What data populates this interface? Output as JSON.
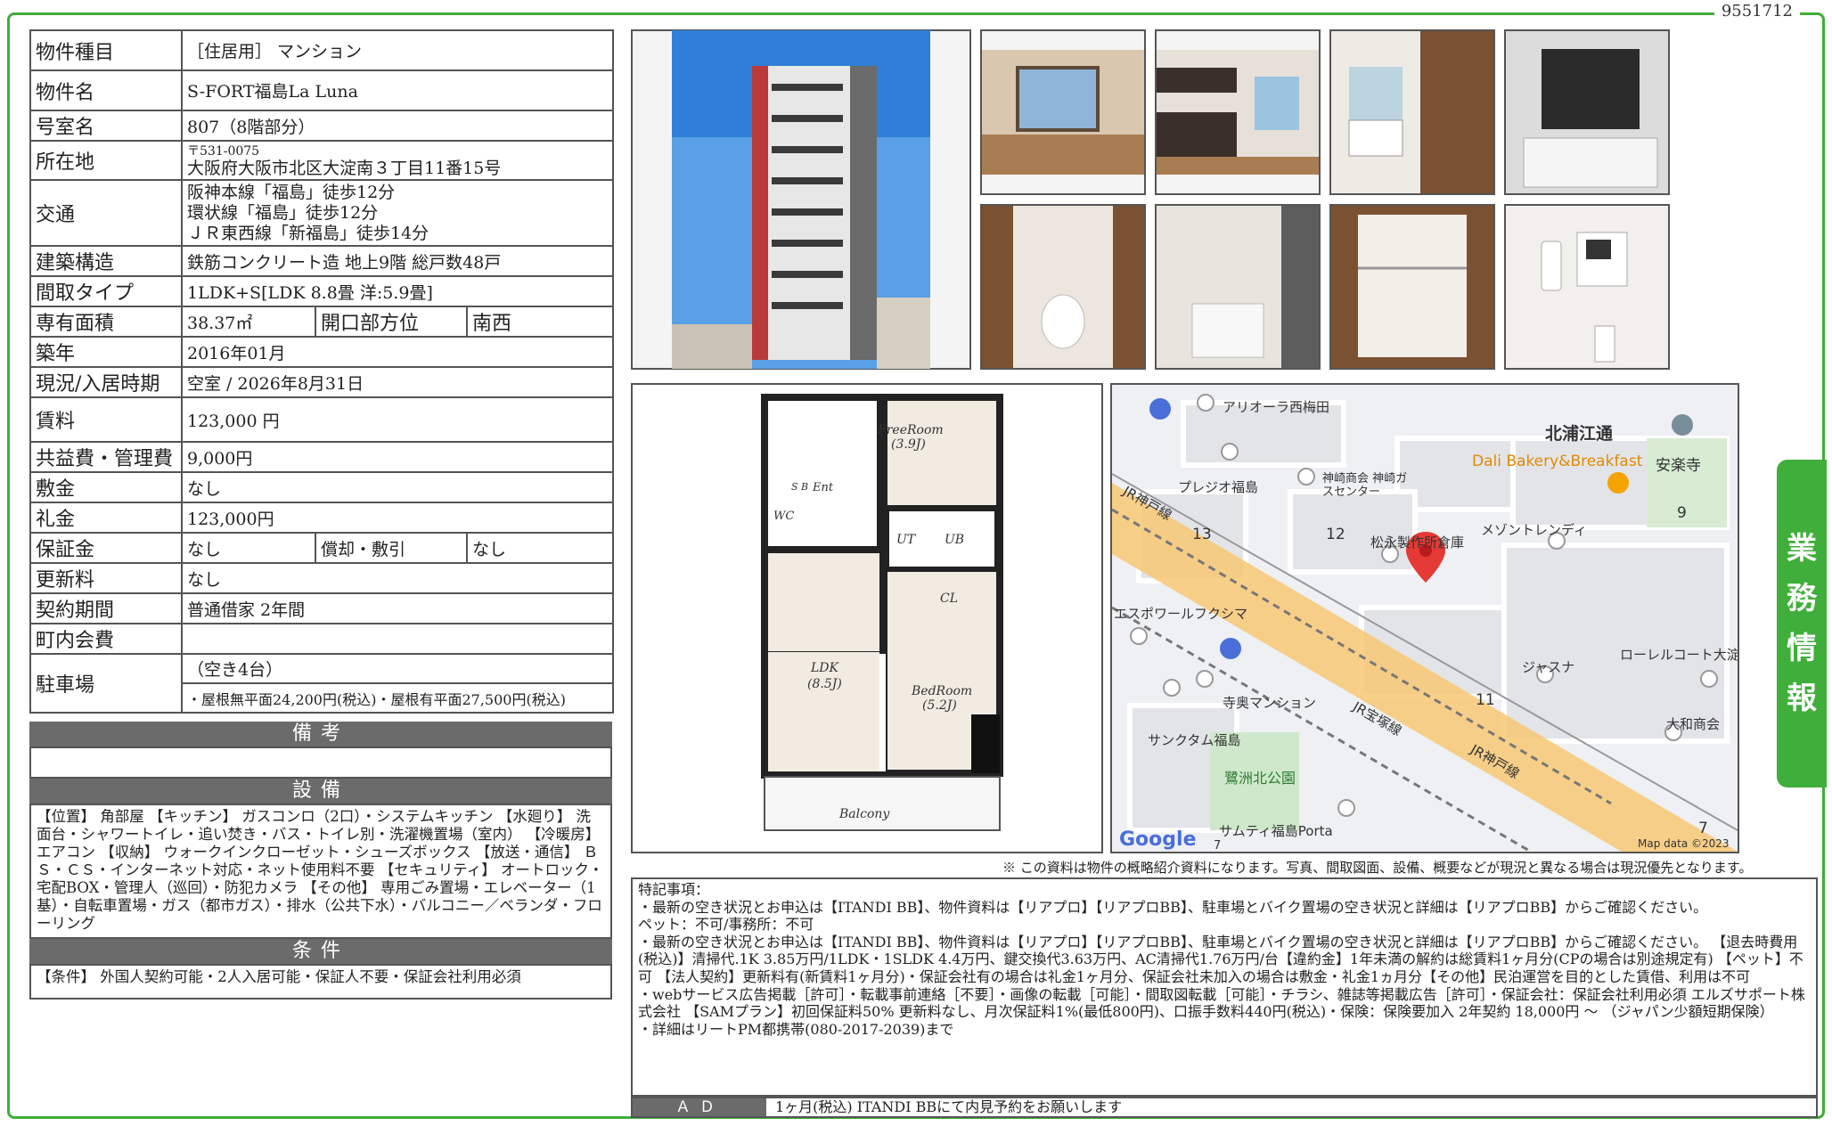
{
  "doc_id": "9551712",
  "side_tab": [
    "業",
    "務",
    "情",
    "報"
  ],
  "rows": {
    "type_label": "物件種目",
    "type_value": "［住居用］ マンション",
    "name_label": "物件名",
    "name_value": "S-FORT福島La Luna",
    "room_label": "号室名",
    "room_value": "807（8階部分）",
    "addr_label": "所在地",
    "addr_zip": "〒531-0075",
    "addr_value": "大阪府大阪市北区大淀南３丁目11番15号",
    "access_label": "交通",
    "access_1": "阪神本線「福島」徒歩12分",
    "access_2": "環状線「福島」徒歩12分",
    "access_3": "ＪＲ東西線「新福島」徒歩14分",
    "struct_label": "建築構造",
    "struct_value": "鉄筋コンクリート造 地上9階 総戸数48戸",
    "layout_label": "間取タイプ",
    "layout_value": "1LDK+S[LDK 8.8畳 洋:5.9畳]",
    "area_label": "専有面積",
    "area_value": "38.37㎡",
    "dir_label": "開口部方位",
    "dir_value": "南西",
    "built_label": "築年",
    "built_value": "2016年01月",
    "status_label": "現況/入居時期",
    "status_value": "空室 / 2026年8月31日",
    "rent_label": "賃料",
    "rent_value": "123,000 円",
    "fee_label": "共益費・管理費",
    "fee_value": "9,000円",
    "deposit_label": "敷金",
    "deposit_value": "なし",
    "key_label": "礼金",
    "key_value": "123,000円",
    "guar_label": "保証金",
    "guar_value": "なし",
    "amort_label": "償却・敷引",
    "amort_value": "なし",
    "renew_label": "更新料",
    "renew_value": "なし",
    "term_label": "契約期間",
    "term_value": "普通借家 2年間",
    "town_label": "町内会費",
    "town_value": "",
    "park_label": "駐車場",
    "park_value1": "（空き4台）",
    "park_value2": "・屋根無平面24,200円(税込)・屋根有平面27,500円(税込)"
  },
  "sections": {
    "biko": "備考",
    "setsubi": "設備",
    "joken": "条件",
    "ad": "ＡＤ"
  },
  "setsubi_text": "【位置】 角部屋 【キッチン】 ガスコンロ（2口）・システムキッチン 【水廻り】 洗面台・シャワートイレ・追い焚き・バス・トイレ別・洗濯機置場（室内） 【冷暖房】 エアコン 【収納】 ウォークインクローゼット・シューズボックス 【放送・通信】 ＢＳ・ＣＳ・インターネット対応・ネット使用料不要 【セキュリティ】 オートロック・宅配BOX・管理人（巡回）・防犯カメラ 【その他】 専用ごみ置場・エレベーター（1基）・自転車置場・ガス（都市ガス）・排水（公共下水）・バルコニー／ベランダ・フローリング",
  "joken_text": "【条件】 外国人契約可能・2人入居可能・保証人不要・保証会社利用必須",
  "note": "※ この資料は物件の概略紹介資料になります。写真、間取図面、設備、概要などが現況と異なる場合は現況優先となります。",
  "remarks": [
    "特記事項：",
    "・最新の空き状況とお申込は【ITANDI BB】、物件資料は【リアプロ】【リアプロBB】、駐車場とバイク置場の空き状況と詳細は【リアプロBB】からご確認ください。",
    "ペット：不可/事務所：不可",
    "・最新の空き状況とお申込は【ITANDI BB】、物件資料は【リアプロ】【リアプロBB】、駐車場とバイク置場の空き状況と詳細は【リアプロBB】からご確認ください。 【退去時費用(税込)】清掃代.1K 3.85万円/1LDK・1SLDK 4.4万円、鍵交換代3.63万円、AC清掃代1.76万円/台【違約金】1年未満の解約は総賃料1ヶ月分(CPの場合は別途規定有) 【ペット】不可 【法人契約】更新料有(新賃料1ヶ月分)・保証会社有の場合は礼金1ヶ月分、保証会社未加入の場合は敷金・礼金1ヵ月分【その他】民泊運営を目的とした賃借、利用は不可",
    "・webサービス広告掲載［許可］・転載事前連絡［不要］・画像の転載［可能］・間取図転載［可能］・チラシ、雑誌等掲載広告［許可］・保証会社：保証会社利用必須 エルズサポート株式会社 【SAMプラン】初回保証料50% 更新料なし、月次保証料1%(最低800円)、口振手数料440円(税込)・保険：保険要加入 2年契約 18,000円 〜 （ジャパン少額短期保険）",
    "・詳細はリートPM都携帯(080-2017-2039)まで"
  ],
  "ad_text": "1ヶ月(税込) ITANDI BBにて内見予約をお願いします",
  "floorplan": {
    "free": "FreeRoom",
    "free_size": "(3.9J)",
    "sb": "S B",
    "ent": "Ent",
    "wc": "WC",
    "ut": "UT",
    "ub": "UB",
    "cl": "CL",
    "ldk": "LDK",
    "ldk_size": "(8.5J)",
    "bed": "BedRoom",
    "bed_size": "(5.2J)",
    "balcony": "Balcony"
  },
  "map": {
    "l1": "アリオーラ西梅田",
    "l2": "北浦江通",
    "l3": "Dali Bakery&Breakfast",
    "l4": "安楽寺",
    "l5": "プレジオ福島",
    "l6": "神崎商会 神崎ガスセンター",
    "l7": "メゾントレンディ",
    "l8": "松永製作所倉庫",
    "l9": "エスポワールフクシマ",
    "l10": "ジャスナ",
    "l11": "ローレルコート大淀",
    "l12": "寺奥マンション",
    "l13": "JR宝塚線",
    "l14": "JR神戸線",
    "l15": "JR神戸線",
    "l16": "サンクタム福島",
    "l17": "鷺洲北公園",
    "l18": "大和商会",
    "l19": "サムティ福島Porta",
    "n13": "13",
    "n12": "12",
    "n9": "9",
    "n11": "11",
    "n7": "7",
    "n7b": "7",
    "google": "Google",
    "mapdata": "Map data ©2023"
  },
  "colors": {
    "accent": "#3fae3a",
    "header": "#6b6b6b",
    "pin": "#e53935"
  }
}
